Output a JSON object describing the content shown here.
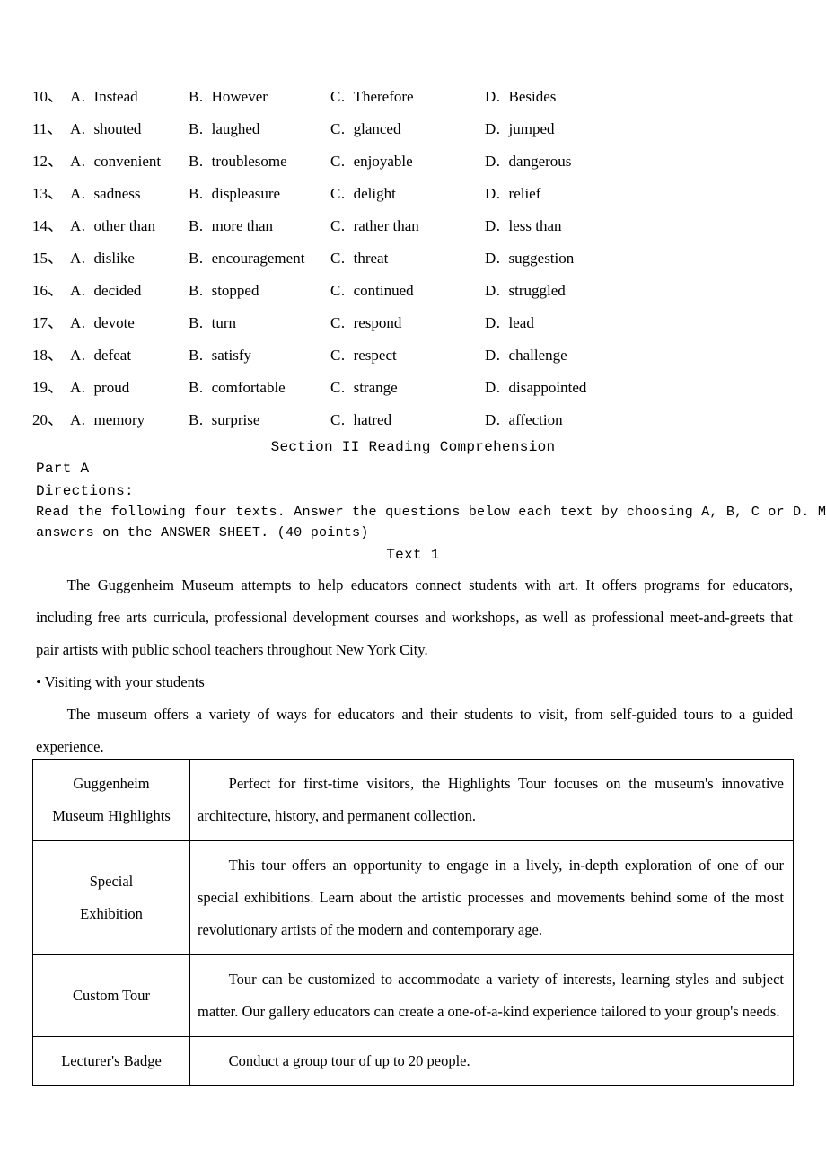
{
  "multiple_choice": [
    {
      "number": "10、",
      "options": [
        {
          "letter": "A.",
          "text": "Instead"
        },
        {
          "letter": "B.",
          "text": "However"
        },
        {
          "letter": "C.",
          "text": "Therefore"
        },
        {
          "letter": "D.",
          "text": "Besides"
        }
      ]
    },
    {
      "number": "11、",
      "options": [
        {
          "letter": "A.",
          "text": "shouted"
        },
        {
          "letter": "B.",
          "text": "laughed"
        },
        {
          "letter": "C.",
          "text": "glanced"
        },
        {
          "letter": "D.",
          "text": "jumped"
        }
      ]
    },
    {
      "number": "12、",
      "options": [
        {
          "letter": "A.",
          "text": "convenient"
        },
        {
          "letter": "B.",
          "text": "troublesome"
        },
        {
          "letter": "C.",
          "text": "enjoyable"
        },
        {
          "letter": "D.",
          "text": "dangerous"
        }
      ]
    },
    {
      "number": "13、",
      "options": [
        {
          "letter": "A.",
          "text": "sadness"
        },
        {
          "letter": "B.",
          "text": "displeasure"
        },
        {
          "letter": "C.",
          "text": "delight"
        },
        {
          "letter": "D.",
          "text": "relief"
        }
      ]
    },
    {
      "number": "14、",
      "options": [
        {
          "letter": "A.",
          "text": "other than"
        },
        {
          "letter": "B.",
          "text": "more than"
        },
        {
          "letter": "C.",
          "text": "rather than"
        },
        {
          "letter": "D.",
          "text": "less than"
        }
      ]
    },
    {
      "number": "15、",
      "options": [
        {
          "letter": "A.",
          "text": "dislike"
        },
        {
          "letter": "B.",
          "text": "encouragement"
        },
        {
          "letter": "C.",
          "text": "threat"
        },
        {
          "letter": "D.",
          "text": "suggestion"
        }
      ]
    },
    {
      "number": "16、",
      "options": [
        {
          "letter": "A.",
          "text": "decided"
        },
        {
          "letter": "B.",
          "text": "stopped"
        },
        {
          "letter": "C.",
          "text": "continued"
        },
        {
          "letter": "D.",
          "text": "struggled"
        }
      ]
    },
    {
      "number": "17、",
      "options": [
        {
          "letter": "A.",
          "text": "devote"
        },
        {
          "letter": "B.",
          "text": "turn"
        },
        {
          "letter": "C.",
          "text": "respond"
        },
        {
          "letter": "D.",
          "text": "lead"
        }
      ]
    },
    {
      "number": "18、",
      "options": [
        {
          "letter": "A.",
          "text": "defeat"
        },
        {
          "letter": "B.",
          "text": "satisfy"
        },
        {
          "letter": "C.",
          "text": "respect"
        },
        {
          "letter": "D.",
          "text": "challenge"
        }
      ]
    },
    {
      "number": "19、",
      "options": [
        {
          "letter": "A.",
          "text": "proud"
        },
        {
          "letter": "B.",
          "text": "comfortable"
        },
        {
          "letter": "C.",
          "text": "strange"
        },
        {
          "letter": "D.",
          "text": "disappointed"
        }
      ]
    },
    {
      "number": "20、",
      "options": [
        {
          "letter": "A.",
          "text": "memory"
        },
        {
          "letter": "B.",
          "text": "surprise"
        },
        {
          "letter": "C.",
          "text": "hatred"
        },
        {
          "letter": "D.",
          "text": "affection"
        }
      ]
    }
  ],
  "section": {
    "title": "Section II Reading Comprehension",
    "part_label": "Part A",
    "directions_label": "Directions:",
    "directions_line1": "Read the following four texts. Answer the questions below each text by choosing A, B, C or D. Mark your",
    "directions_line2": "answers on the ANSWER SHEET. (40 points)",
    "text_title": "Text 1"
  },
  "passage": {
    "paragraph1": "The Guggenheim Museum attempts to help educators connect students with art. It offers programs for educators, including free arts curricula, professional development courses and workshops, as well as professional meet-and-greets that pair artists with public school teachers throughout New York City.",
    "bullet1": "• Visiting with your students",
    "paragraph2": "The museum offers a variety of ways for educators and their students to visit, from self-guided tours to a guided experience."
  },
  "tour_table": {
    "rows": [
      {
        "label_line1": "Guggenheim",
        "label_line2": "Museum Highlights",
        "description": "Perfect for first-time visitors, the Highlights Tour focuses on the museum's innovative architecture, history, and permanent collection."
      },
      {
        "label_line1": "Special",
        "label_line2": "Exhibition",
        "description": "This tour offers an opportunity to engage in a lively, in-depth exploration of one of our special exhibitions. Learn about the artistic processes and movements behind some of the most revolutionary artists of the modern and contemporary age."
      },
      {
        "label_line1": "Custom Tour",
        "label_line2": "",
        "description": "Tour can be customized to accommodate a variety of interests, learning styles and subject matter. Our gallery educators can create a one-of-a-kind experience tailored to your group's needs."
      },
      {
        "label_line1": "Lecturer's Badge",
        "label_line2": "",
        "description": "Conduct a group tour of up to 20 people."
      }
    ]
  }
}
